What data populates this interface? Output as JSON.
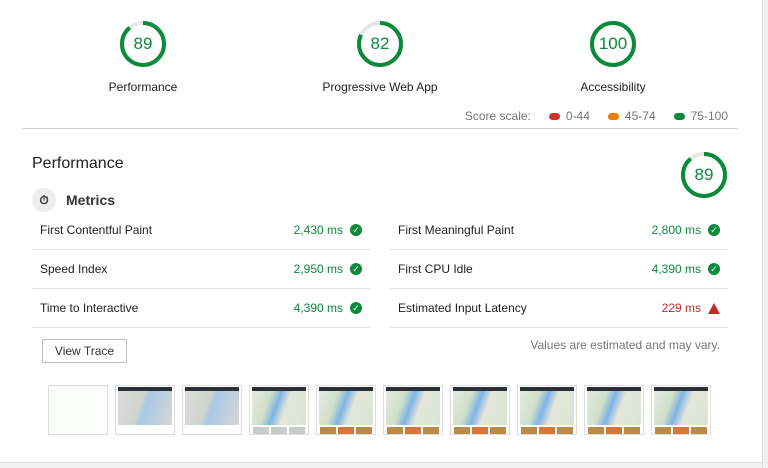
{
  "categories": [
    {
      "label": "Performance",
      "score": 89
    },
    {
      "label": "Progressive Web App",
      "score": 82
    },
    {
      "label": "Accessibility",
      "score": 100
    }
  ],
  "score_scale": {
    "label": "Score scale:",
    "ranges": [
      {
        "label": "0-44",
        "color": "#d32f2f"
      },
      {
        "label": "45-74",
        "color": "#ef7c00"
      },
      {
        "label": "75-100",
        "color": "#0a8a3a"
      }
    ]
  },
  "section": {
    "title": "Performance",
    "score": 89,
    "metrics_label": "Metrics",
    "metrics_icon": "stopwatch-icon"
  },
  "metrics_left": [
    {
      "name": "First Contentful Paint",
      "value": "2,430 ms",
      "status": "pass"
    },
    {
      "name": "Speed Index",
      "value": "2,950 ms",
      "status": "pass"
    },
    {
      "name": "Time to Interactive",
      "value": "4,390 ms",
      "status": "pass"
    }
  ],
  "metrics_right": [
    {
      "name": "First Meaningful Paint",
      "value": "2,800 ms",
      "status": "pass"
    },
    {
      "name": "First CPU Idle",
      "value": "4,390 ms",
      "status": "pass"
    },
    {
      "name": "Estimated Input Latency",
      "value": "229 ms",
      "status": "fail"
    }
  ],
  "view_trace_label": "View Trace",
  "note": "Values are estimated and may vary."
}
